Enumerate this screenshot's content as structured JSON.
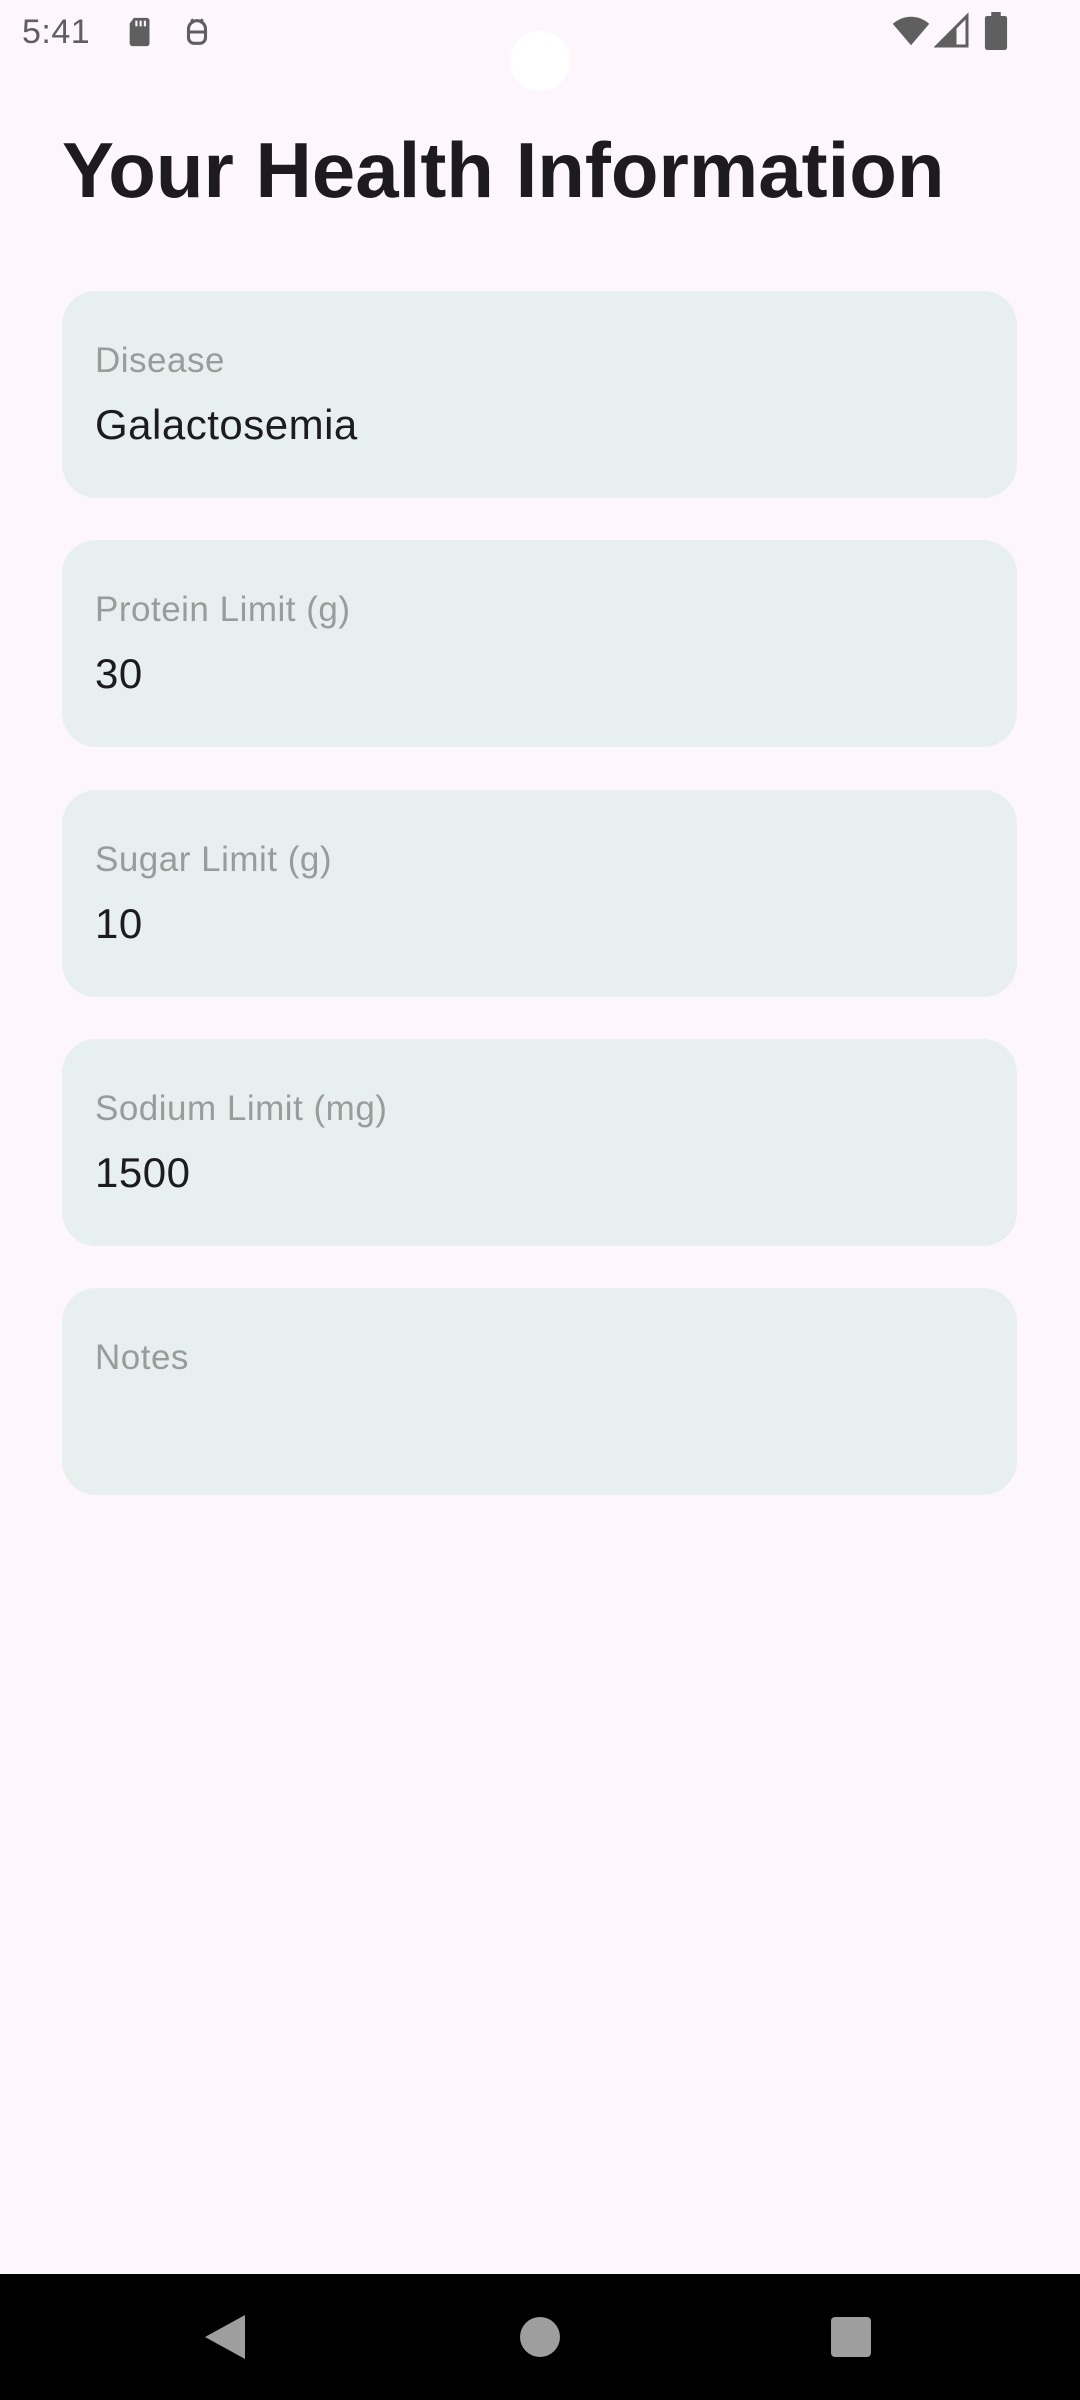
{
  "status_bar": {
    "time": "5:41",
    "left_icons": [
      "sd-card-icon",
      "android-debug-icon"
    ],
    "right_icons": [
      "wifi-icon",
      "cellular-signal-icon",
      "battery-icon"
    ]
  },
  "page": {
    "title": "Your Health Information"
  },
  "fields": [
    {
      "label": "Disease",
      "value": "Galactosemia"
    },
    {
      "label": "Protein Limit (g)",
      "value": "30"
    },
    {
      "label": "Sugar Limit (g)",
      "value": "10"
    },
    {
      "label": "Sodium Limit (mg)",
      "value": "1500"
    },
    {
      "label": "Notes",
      "value": ""
    }
  ],
  "navigation_bar": {
    "buttons": [
      "back-icon",
      "home-icon",
      "recents-icon"
    ]
  },
  "colors": {
    "background": "#fdf6fd",
    "card": "#e8f0ef",
    "label_text": "#989c9b",
    "value_text": "#1d1b20"
  }
}
